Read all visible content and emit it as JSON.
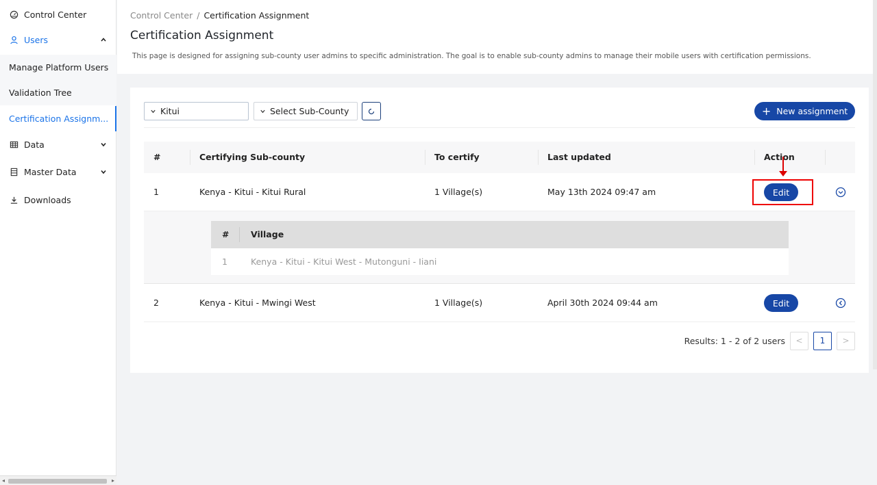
{
  "sidebar": {
    "control_center": "Control Center",
    "users": "Users",
    "manage_platform_users": "Manage Platform Users",
    "validation_tree": "Validation Tree",
    "certification_assignment": "Certification Assignm...",
    "data": "Data",
    "master_data": "Master Data",
    "downloads": "Downloads"
  },
  "header": {
    "breadcrumb_root": "Control Center",
    "breadcrumb_sep": "/",
    "breadcrumb_current": "Certification Assignment",
    "title": "Certification Assignment",
    "description": "This page is designed for assigning sub-county user admins to specific administration. The goal is to enable sub-county admins to manage their mobile users with certification permissions."
  },
  "filters": {
    "county_value": "Kitui",
    "subcounty_placeholder": "Select Sub-County",
    "new_assignment_label": "New assignment"
  },
  "table": {
    "columns": [
      "#",
      "Certifying Sub-county",
      "To certify",
      "Last updated",
      "Action"
    ],
    "rows": [
      {
        "num": "1",
        "subcounty": "Kenya - Kitui - Kitui Rural",
        "to_certify": "1 Village(s)",
        "updated": "May 13th 2024 09:47 am",
        "action": "Edit"
      },
      {
        "num": "2",
        "subcounty": "Kenya - Kitui - Mwingi West",
        "to_certify": "1 Village(s)",
        "updated": "April 30th 2024 09:44 am",
        "action": "Edit"
      }
    ],
    "expanded": {
      "columns": [
        "#",
        "Village"
      ],
      "rows": [
        {
          "num": "1",
          "village": "Kenya - Kitui - Kitui West - Mutonguni - Iiani"
        }
      ]
    }
  },
  "pagination": {
    "results": "Results: 1 - 2 of 2 users",
    "prev": "<",
    "current": "1",
    "next": ">"
  },
  "colors": {
    "accent": "#1747a6",
    "link": "#1a73e8",
    "annotation": "#e00000"
  }
}
